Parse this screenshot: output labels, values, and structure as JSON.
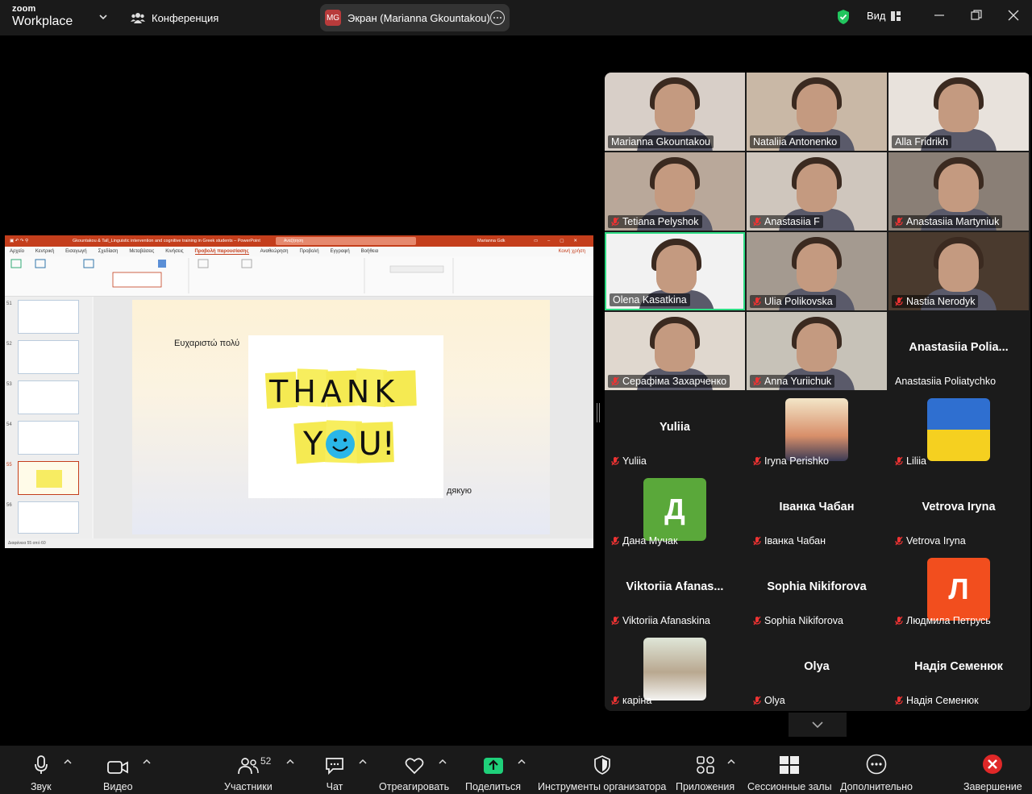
{
  "topbar": {
    "brand_line1": "zoom",
    "brand_line2": "Workplace",
    "conference_label": "Конференция",
    "share_initials": "MG",
    "share_label": "Экран (Marianna Gkountakou)",
    "view_label": "Вид"
  },
  "presentation": {
    "window_title": "Gkountakou & Tall_Linguistic intervention and cognitive training in Greek students  –  PowerPoint",
    "search_placeholder": "Αναζήτηση",
    "user_name": "Marianna Gdk",
    "menu": [
      "Αρχείο",
      "Κεντρική",
      "Εισαγωγή",
      "Σχεδίαση",
      "Μεταβάσεις",
      "Κινήσεις",
      "Προβολή παρουσίασης",
      "Αναθεώρηση",
      "Προβολή",
      "Εγγραφή",
      "Βοήθεια"
    ],
    "share_btn": "Κοινή χρήση",
    "slide_numbers": [
      "51",
      "52",
      "53",
      "54",
      "55",
      "56"
    ],
    "slide_text_1": "Ευχαριστώ πολύ",
    "slide_text_2": "дякую",
    "img_line1": "THANK",
    "img_line2_a": "Y",
    "img_line2_b": "U!",
    "status": "Διαφάνεια 55 από 60"
  },
  "participants": [
    {
      "name": "Marianna Gkountakou",
      "type": "video",
      "muted": false
    },
    {
      "name": "Nataliia Antonenko",
      "type": "video",
      "muted": false
    },
    {
      "name": "Alla Fridrikh",
      "type": "video",
      "muted": false
    },
    {
      "name": "Tetiana Pelyshok",
      "type": "video",
      "muted": true
    },
    {
      "name": "Anastasiia F",
      "type": "video",
      "muted": true
    },
    {
      "name": "Anastasiia Martyniuk",
      "type": "video",
      "muted": true
    },
    {
      "name": "Olena Kasatkina",
      "type": "video",
      "muted": false,
      "active": true
    },
    {
      "name": "Ulia Polikovska",
      "type": "video",
      "muted": true
    },
    {
      "name": "Nastia Nerodyk",
      "type": "video",
      "muted": true
    },
    {
      "name": "Серафіма Захарченко",
      "type": "video",
      "muted": true
    },
    {
      "name": "Anna Yuriichuk",
      "type": "video",
      "muted": true
    },
    {
      "name": "Anastasiia Poliatychko",
      "display": "Anastasiia  Polia...",
      "type": "name",
      "muted": false
    },
    {
      "name": "Yuliia",
      "display": "Yuliia",
      "type": "name",
      "muted": true
    },
    {
      "name": "Iryna Perishko",
      "type": "photo",
      "muted": true
    },
    {
      "name": "Liliia",
      "type": "flag",
      "muted": true
    },
    {
      "name": "Дана Мучак",
      "type": "avatar",
      "letter": "Д",
      "color": "#5aa83a",
      "muted": true
    },
    {
      "name": "Іванка Чабан",
      "display": "Іванка Чабан",
      "type": "name",
      "muted": true
    },
    {
      "name": "Vetrova Iryna",
      "display": "Vetrova Iryna",
      "type": "name",
      "muted": true
    },
    {
      "name": "Viktoriia Afanaskina",
      "display": "Viktoriia  Afanas...",
      "type": "name",
      "muted": true
    },
    {
      "name": "Sophia Nikiforova",
      "display": "Sophia Nikiforova",
      "type": "name",
      "muted": true
    },
    {
      "name": "Людмила Петрусь",
      "type": "avatar",
      "letter": "Л",
      "color": "#f24e1e",
      "muted": true
    },
    {
      "name": "каріна",
      "type": "photo2",
      "muted": true
    },
    {
      "name": "Olya",
      "display": "Olya",
      "type": "name",
      "muted": true
    },
    {
      "name": "Надія Семенюк",
      "display": "Надія Семенюк",
      "type": "name",
      "muted": true
    }
  ],
  "toolbar": {
    "audio": "Звук",
    "video": "Видео",
    "participants": "Участники",
    "participants_count": "52",
    "chat": "Чат",
    "react": "Отреагировать",
    "share": "Поделиться",
    "host_tools": "Инструменты организатора",
    "apps": "Приложения",
    "breakout": "Сессионные залы",
    "more": "Дополнительно",
    "end": "Завершение"
  },
  "colors": {
    "accent_green": "#2edc84",
    "end_red": "#e02828",
    "share_green": "#1fd07a",
    "ppt_red": "#c43e1c"
  }
}
